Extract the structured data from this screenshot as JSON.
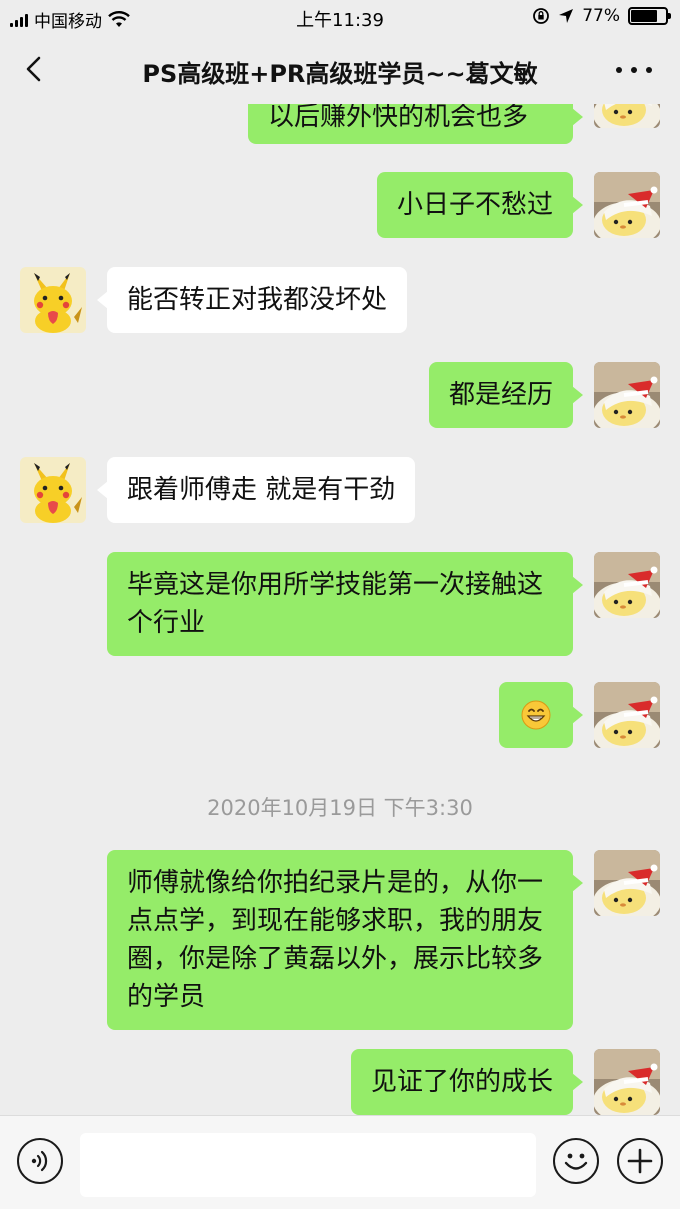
{
  "status_bar": {
    "carrier": "中国移动",
    "time": "上午11:39",
    "battery": "77%",
    "battery_level": 0.77
  },
  "nav": {
    "title": "PS高级班+PR高级班学员~~葛文敏"
  },
  "messages": [
    {
      "side": "out",
      "text": "以后赚外快的机会也多"
    },
    {
      "side": "out",
      "text": "小日子不愁过"
    },
    {
      "side": "in",
      "text": "能否转正对我都没坏处"
    },
    {
      "side": "out",
      "text": "都是经历"
    },
    {
      "side": "in",
      "text": "跟着师傅走 就是有干劲"
    },
    {
      "side": "out",
      "text": "毕竟这是你用所学技能第一次接触这个行业"
    },
    {
      "side": "out",
      "emoji": "grinning-face"
    },
    {
      "side": "out",
      "text": "师傅就像给你拍纪录片是的，从你一点点学，到现在能够求职，我的朋友圈，你是除了黄磊以外，展示比较多的学员"
    },
    {
      "side": "out",
      "text": "见证了你的成长"
    }
  ],
  "timestamp": "2020年10月19日 下午3:30",
  "input_bar": {
    "voice_icon": "voice-icon",
    "emoji_icon": "emoji-icon",
    "plus_icon": "plus-icon",
    "input_value": ""
  },
  "colors": {
    "background": "#ededed",
    "outgoing_bubble": "#95ec69",
    "incoming_bubble": "#ffffff"
  }
}
